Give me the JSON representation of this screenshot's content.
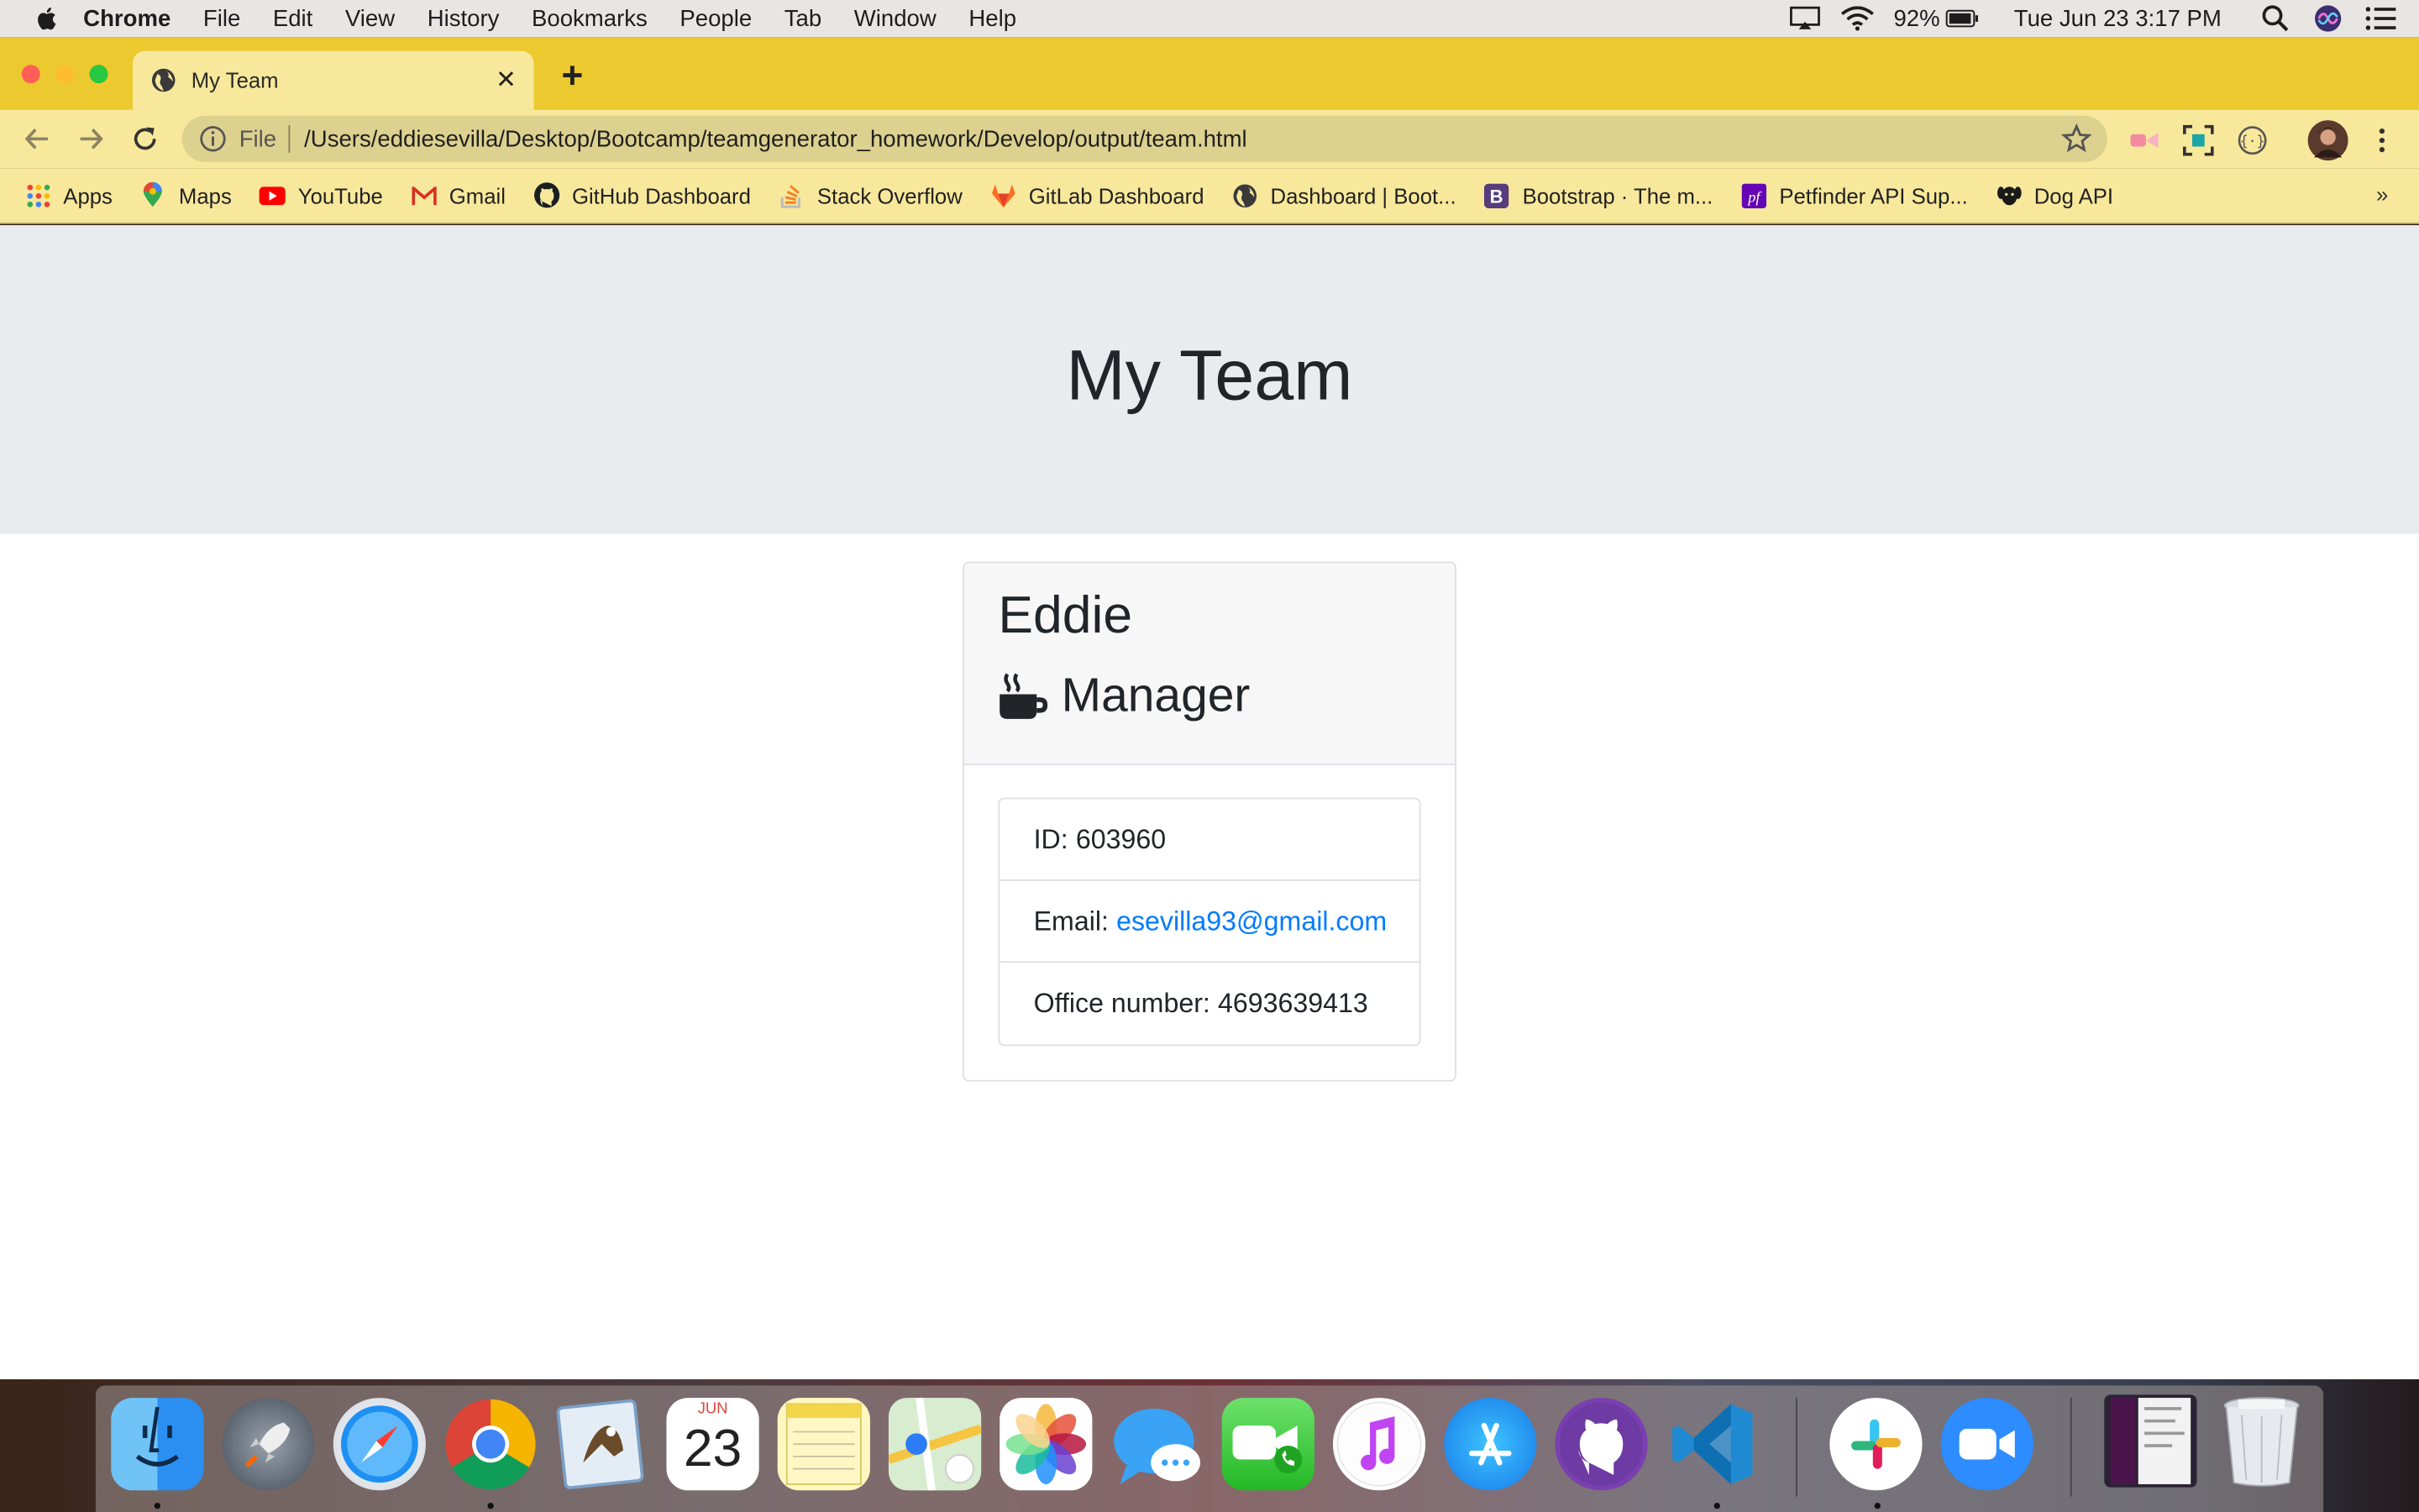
{
  "menubar": {
    "app": "Chrome",
    "items": [
      "File",
      "Edit",
      "View",
      "History",
      "Bookmarks",
      "People",
      "Tab",
      "Window",
      "Help"
    ],
    "battery": "92%",
    "clock": "Tue Jun 23  3:17 PM"
  },
  "browser": {
    "tab_title": "My Team",
    "tab_close": "✕",
    "new_tab": "+",
    "scheme": "File",
    "url": "/Users/eddiesevilla/Desktop/Bootcamp/teamgenerator_homework/Develop/output/team.html",
    "bookmarks": [
      "Apps",
      "Maps",
      "YouTube",
      "Gmail",
      "GitHub Dashboard",
      "Stack Overflow",
      "GitLab Dashboard",
      "Dashboard | Boot...",
      "Bootstrap · The m...",
      "Petfinder API Sup...",
      "Dog API"
    ],
    "bookmarks_more": "»"
  },
  "page": {
    "heading": "My Team",
    "card": {
      "name": "Eddie",
      "role": "Manager",
      "id_label": "ID:",
      "id_value": "603960",
      "email_label": "Email:",
      "email_value": "esevilla93@gmail.com",
      "office_label": "Office number:",
      "office_value": "4693639413"
    }
  },
  "dock": {
    "calendar_month": "JUN",
    "calendar_day": "23"
  },
  "colors": {
    "tabstrip": "#ecc92f",
    "toolbar": "#f8e89b",
    "jumbotron": "#e9ecef",
    "link": "#007bff"
  }
}
